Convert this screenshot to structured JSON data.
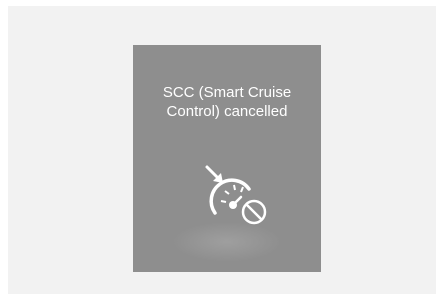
{
  "display": {
    "message_line1": "SCC (Smart Cruise",
    "message_line2": "Control) cancelled",
    "icon": "smart-cruise-control-cancelled-icon"
  },
  "colors": {
    "panel_background": "#f2f2f2",
    "display_background": "#8e8e8e",
    "text": "#ffffff"
  }
}
